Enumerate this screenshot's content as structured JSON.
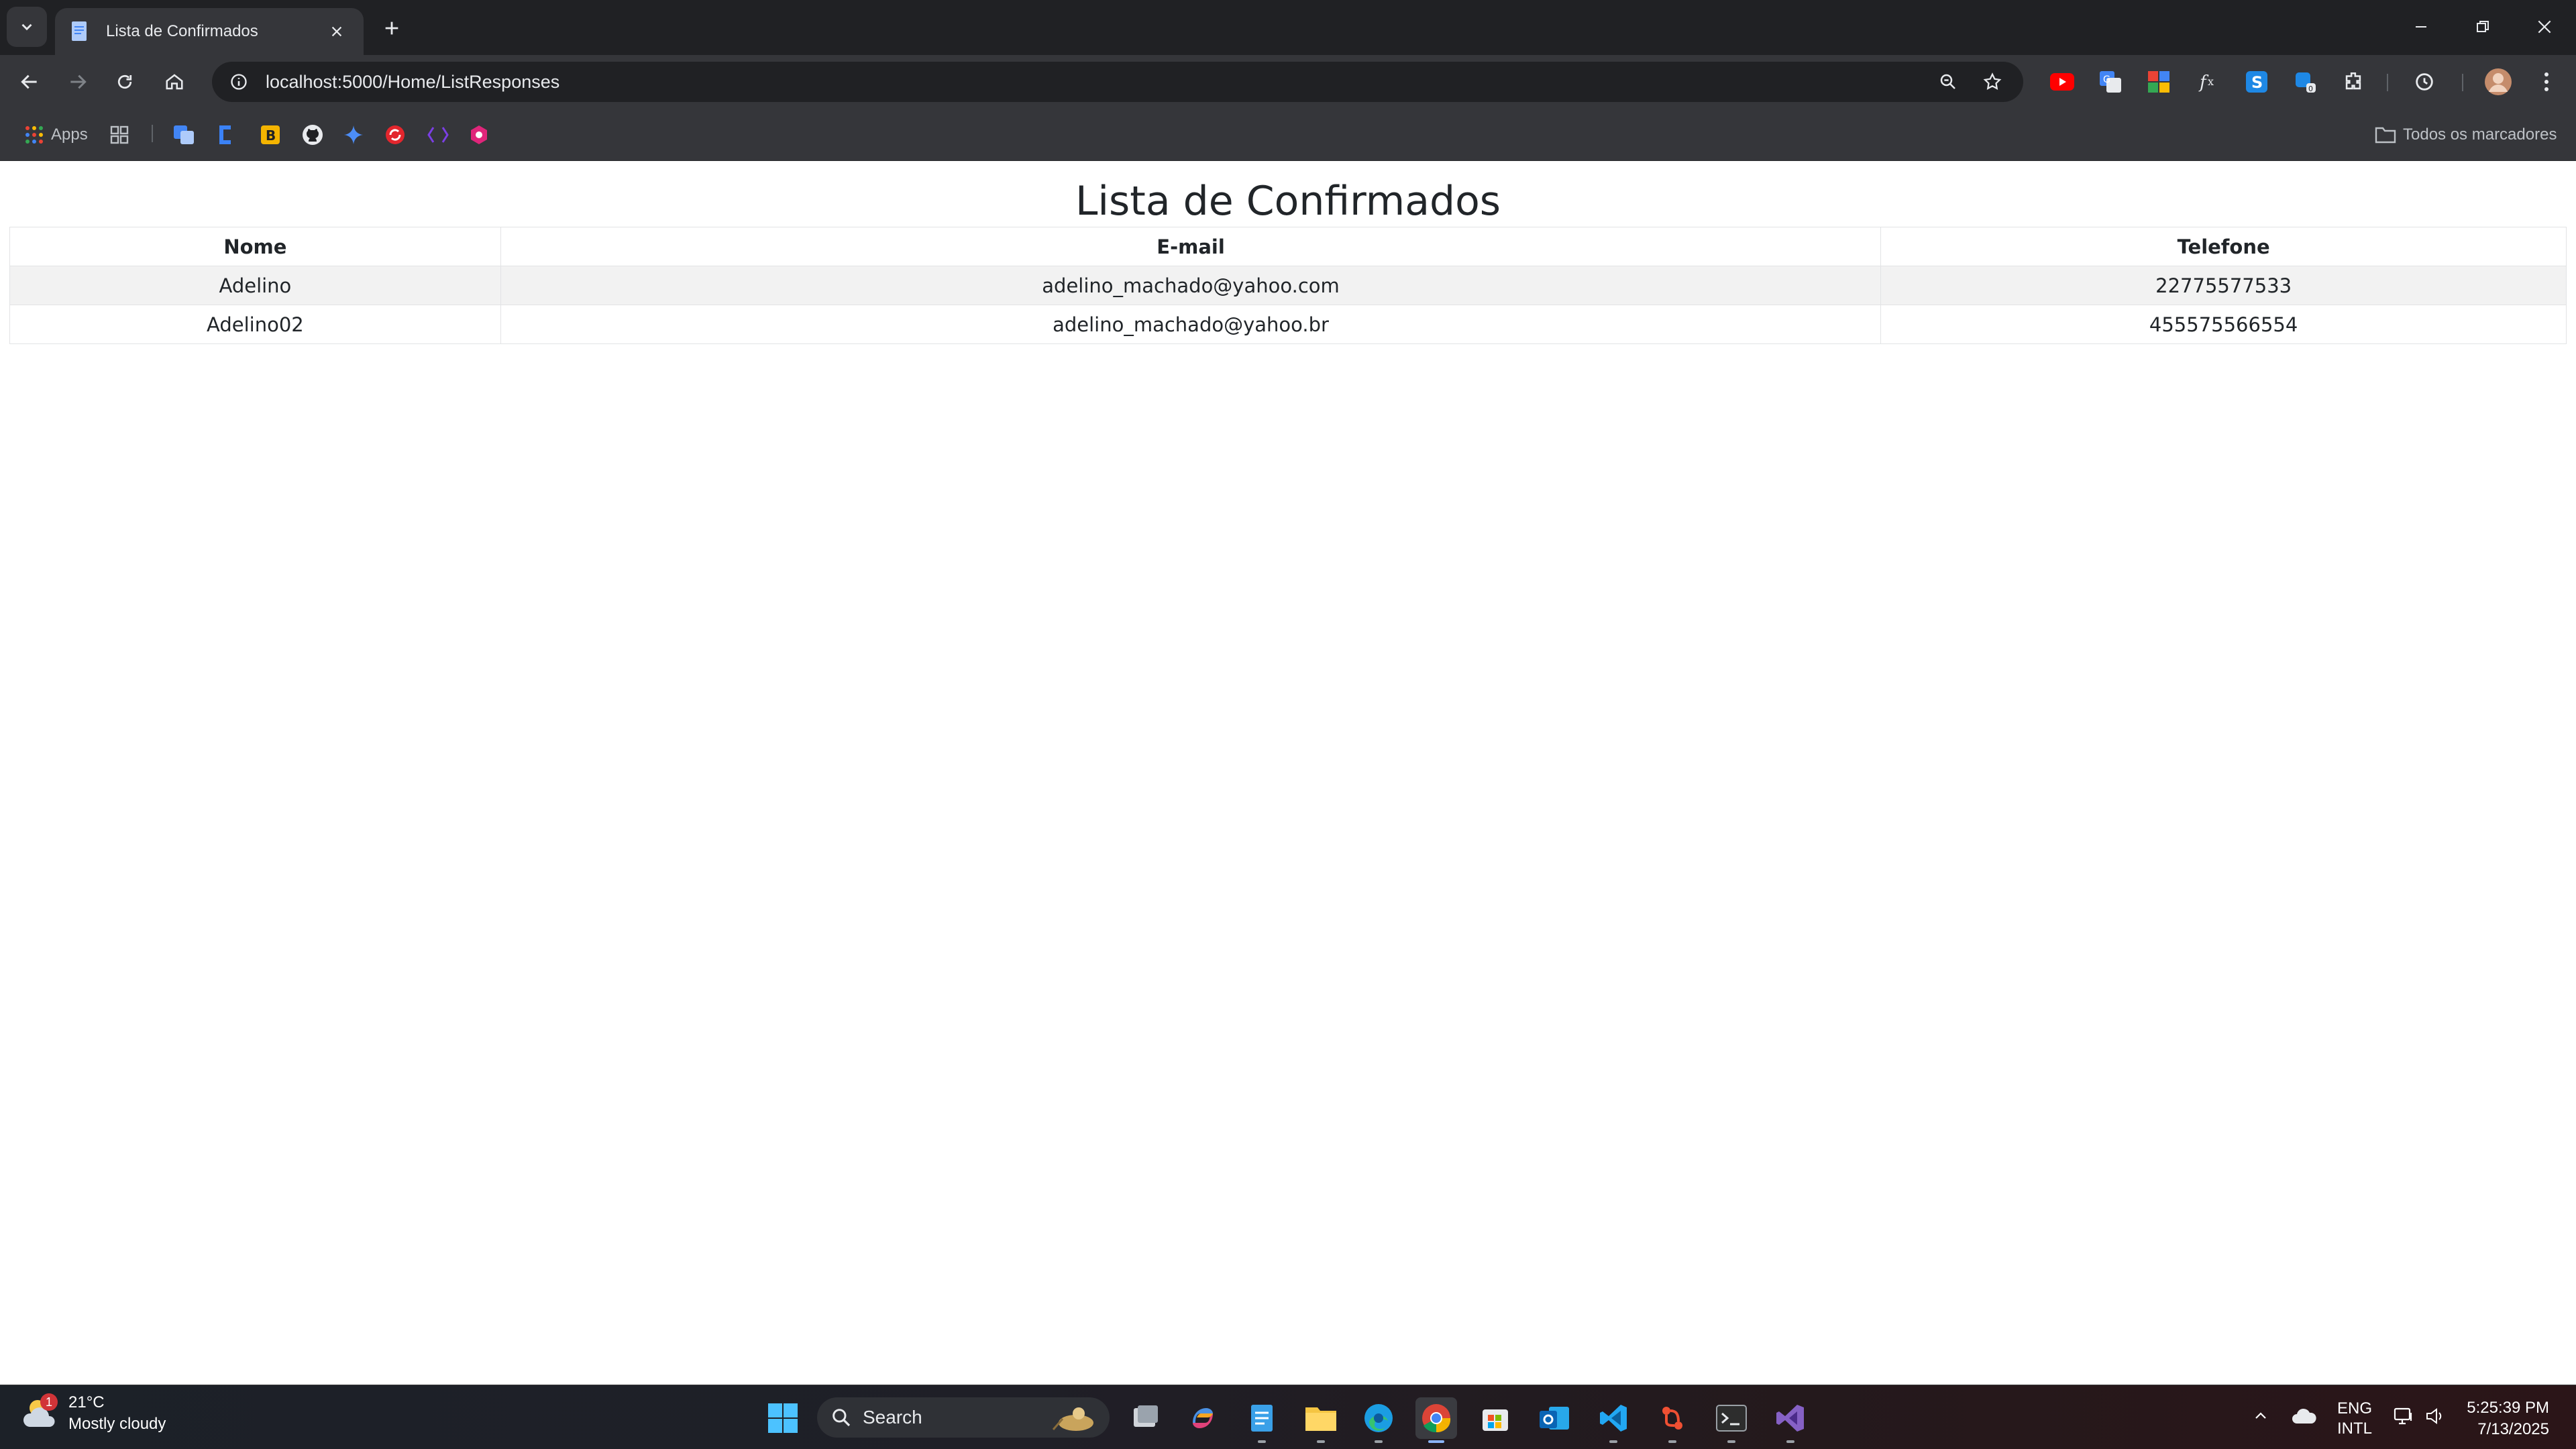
{
  "browser": {
    "tab_title": "Lista de Confirmados",
    "url": "localhost:5000/Home/ListResponses",
    "bookmarks_apps_label": "Apps",
    "all_bookmarks_label": "Todos os marcadores"
  },
  "page": {
    "title": "Lista de Confirmados",
    "table": {
      "headers": [
        "Nome",
        "E-mail",
        "Telefone"
      ],
      "rows": [
        [
          "Adelino",
          "adelino_machado@yahoo.com",
          "22775577533"
        ],
        [
          "Adelino02",
          "adelino_machado@yahoo.br",
          "455575566554"
        ]
      ]
    }
  },
  "taskbar": {
    "weather_temp": "21°C",
    "weather_desc": "Mostly cloudy",
    "weather_badge": "1",
    "search_label": "Search",
    "lang_line1": "ENG",
    "lang_line2": "INTL",
    "time": "5:25:39 PM",
    "date": "7/13/2025"
  },
  "colors": {
    "chrome_dark": "#202124",
    "chrome_toolbar": "#35363a",
    "accent_blue": "#8ab4f8"
  }
}
